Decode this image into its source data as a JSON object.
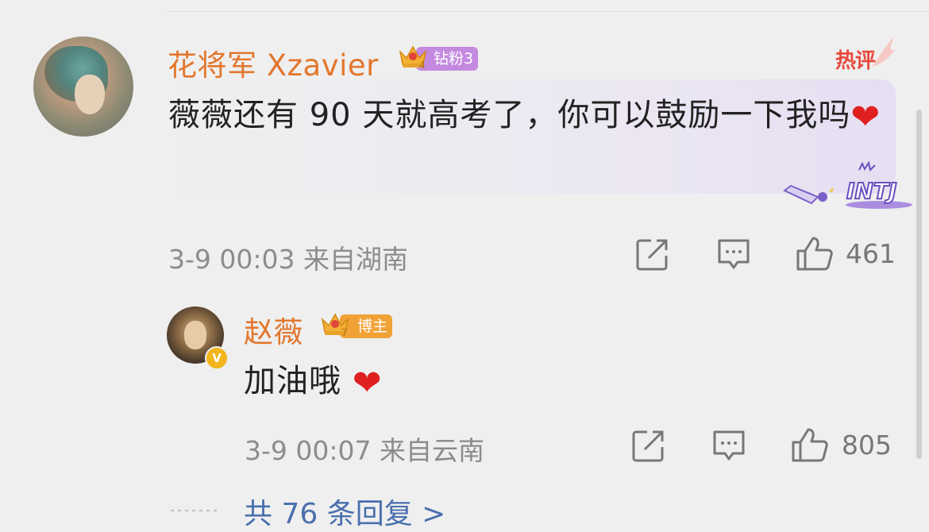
{
  "main_comment": {
    "username": "花将军 Xzavier",
    "badge": "钻粉3",
    "crown_level": "4",
    "hot_label": "热评",
    "text": "薇薇还有 90 天就高考了，你可以鼓励一下我吗",
    "emoji": "❤",
    "timestamp": "3-9 00:03",
    "location": "来自湖南",
    "likes": "461",
    "decoration": "INTJ"
  },
  "reply": {
    "username": "赵薇",
    "badge": "博主",
    "crown_level": "7",
    "verified_mark": "V",
    "text": "加油哦",
    "emoji": "❤",
    "timestamp": "3-9 00:07",
    "location": "来自云南",
    "likes": "805"
  },
  "more_replies": "共 76 条回复 >",
  "colors": {
    "username": "#e2772e",
    "fan_badge": "#c48ae0",
    "host_badge": "#f0a237",
    "hot": "#e64a3d",
    "link": "#4a6fae"
  }
}
